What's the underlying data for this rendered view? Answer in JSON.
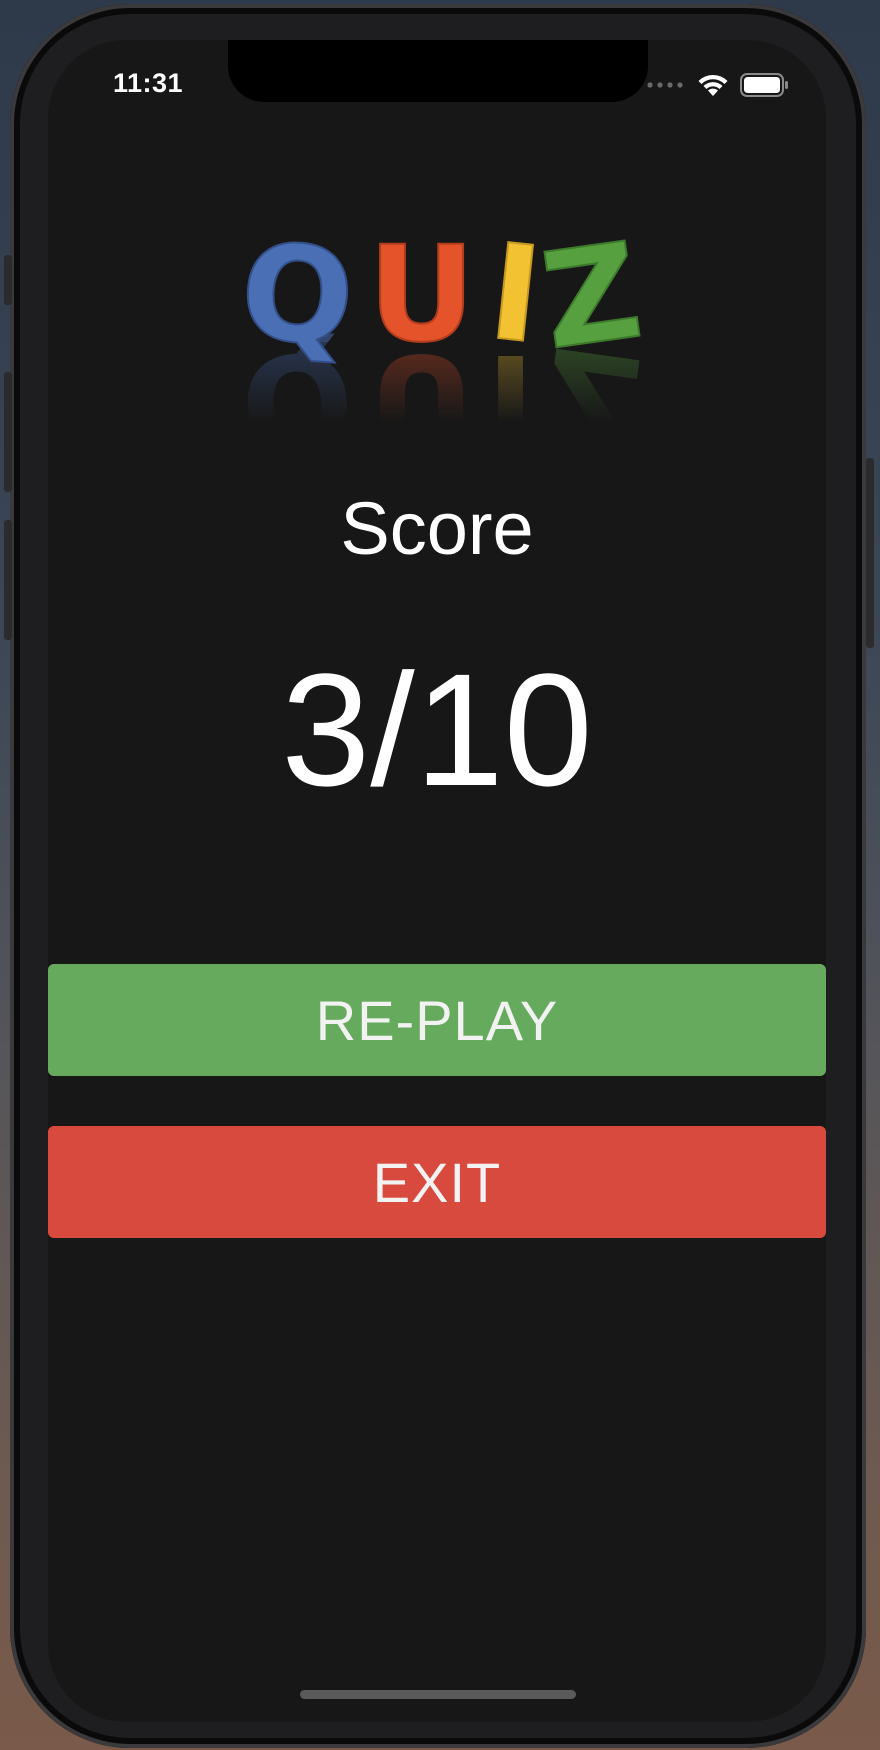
{
  "status_bar": {
    "time": "11:31",
    "icons": [
      "cellular-dots-icon",
      "wifi-icon",
      "battery-icon"
    ]
  },
  "logo": {
    "letters": [
      "Q",
      "U",
      "I",
      "Z"
    ],
    "colors": [
      "#4a6fb5",
      "#e5532b",
      "#f2c233",
      "#57a03f"
    ]
  },
  "result": {
    "label": "Score",
    "value": "3/10"
  },
  "actions": {
    "replay_label": "RE-PLAY",
    "exit_label": "EXIT"
  },
  "theme": {
    "background": "#171717",
    "replay_color": "#66ab5d",
    "exit_color": "#d84a3e"
  }
}
